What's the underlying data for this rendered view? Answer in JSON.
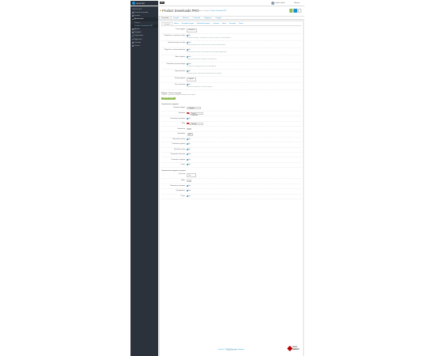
{
  "topbar": {
    "logo_text": "opencart",
    "lang": "RU",
    "user_name": "admin admin",
    "logout": "Выход"
  },
  "sidebar": {
    "header": "НАВИГАЦИЯ",
    "items": [
      {
        "label": "Панель состояния",
        "active": false
      },
      {
        "label": "Каталог",
        "active": false
      },
      {
        "label": "Дополнения",
        "active": true
      },
      {
        "label": "Модули",
        "active": false,
        "sub": true
      },
      {
        "label": "Product Downloads PRO",
        "active": true,
        "sub": true
      },
      {
        "label": "Дизайн",
        "active": false
      },
      {
        "label": "Продажи",
        "active": false
      },
      {
        "label": "Покупатели",
        "active": false
      },
      {
        "label": "Маркетинг",
        "active": false
      },
      {
        "label": "Система",
        "active": false
      },
      {
        "label": "Отчеты",
        "active": false
      }
    ]
  },
  "page": {
    "title": "Product Downloads PRO",
    "crumb_home": "Главная",
    "crumb_sep": "/",
    "crumb_mod": "Модули",
    "crumb_current": "Product Downloads PRO"
  },
  "tabs": [
    "Настройки",
    "Загрузки",
    "Шаблоны",
    "Статистика",
    "Поддержка",
    "О модуле"
  ],
  "subtabs": [
    "Основные",
    "Шаблон",
    "Настройки загрузки",
    "Файловый менеджер",
    "Страница",
    "Форма",
    "Эксплорер",
    "Разное"
  ],
  "settings": [
    {
      "label": "Статус модуля",
      "value": "Включено",
      "hint": ""
    },
    {
      "label": "Отображать на странице товара",
      "value": "Да",
      "hint": "Показывать вкладку с загрузками на странице товара при наличии файлов"
    },
    {
      "label": "Требовать вход в систему",
      "value": "Нет",
      "hint": "Незарегистрированные пользователи не смогут скачивать файлы"
    },
    {
      "label": "Подробные ссылки скачивания",
      "value": "Да",
      "hint": "Использовать понятные ссылки вместо числовых идентификаторов"
    },
    {
      "label": "Лимит загрузок",
      "value": "Нет",
      "hint": "Ограничение количества загрузок на пользователя"
    },
    {
      "label": "Показывать пустые вкладки",
      "value": "Нет",
      "hint": "Отображать вкладку даже при отсутствии файлов"
    },
    {
      "label": "Группа доступа",
      "value": "Да",
      "hint": "Выберите группы покупателей, которым доступны загрузки"
    },
    {
      "label": "Метод загрузки",
      "value": "Прямой",
      "hint": ""
    },
    {
      "label": "Кэш статистики",
      "value": "Да",
      "hint": "Включить кэширование статистики загрузок"
    }
  ],
  "section1": {
    "title": "Модуль 'Список загрузок'",
    "note": "Создание и управление модулями вывода списка загрузок",
    "add_button": "Добавить модуль"
  },
  "module_settings": {
    "title": "Управление модулем",
    "rows": [
      {
        "label": "Название модуля",
        "value": "Загрузки"
      },
      {
        "label": "Заголовок",
        "value": "Product Downloads"
      },
      {
        "label": "Показывать заголовок",
        "value": "Да"
      },
      {
        "label": "Язык",
        "value": "Русский"
      },
      {
        "label": "Количество",
        "value": "5"
      },
      {
        "label": "Сортировка",
        "value": "Дата"
      },
      {
        "label": "Показывать иконку",
        "value": "Да"
      },
      {
        "label": "Показывать размер",
        "value": "Да"
      },
      {
        "label": "Показывать дату",
        "value": "Да"
      },
      {
        "label": "Показывать описание",
        "value": "Нет"
      },
      {
        "label": "Показывать загрузки",
        "value": "Да"
      },
      {
        "label": "Статус",
        "value": "Да"
      }
    ]
  },
  "section2": {
    "title": "Управление модулем загрузок",
    "rows": [
      {
        "label": "Источник",
        "value": "Все"
      },
      {
        "label": "Лимит",
        "value": "10"
      },
      {
        "label": "Показывать категорию",
        "value": "Да"
      },
      {
        "label": "Группировать",
        "value": "Нет"
      },
      {
        "label": "Статус",
        "value": "Да"
      }
    ]
  },
  "footer": {
    "line1": "OpenCart © 2009-2024 Все права защищены.",
    "line2": "Версия 3.0.3.8"
  },
  "stamp": {
    "line1": "GOLD",
    "line2": "MARKET"
  },
  "colors": {
    "accent": "#1e91cf",
    "save": "#8fbb56",
    "sidebar": "#2b323c",
    "warning": "#e3a21a"
  }
}
